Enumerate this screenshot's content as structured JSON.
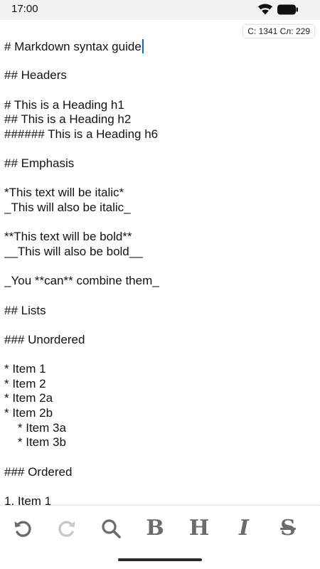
{
  "status_bar": {
    "time": "17:00",
    "wifi_icon": "wifi-icon",
    "battery_icon": "battery-icon"
  },
  "counter": {
    "text": "С: 1341 Сл: 229"
  },
  "editor": {
    "lines": [
      "# Markdown syntax guide",
      "",
      "## Headers",
      "",
      "# This is a Heading h1",
      "## This is a Heading h2",
      "###### This is a Heading h6",
      "",
      "## Emphasis",
      "",
      "*This text will be italic*",
      "_This will also be italic_",
      "",
      "**This text will be bold**",
      "__This will also be bold__",
      "",
      "_You **can** combine them_",
      "",
      "## Lists",
      "",
      "### Unordered",
      "",
      "* Item 1",
      "* Item 2",
      "* Item 2a",
      "* Item 2b",
      "    * Item 3a",
      "    * Item 3b",
      "",
      "### Ordered",
      "",
      "1. Item 1"
    ]
  },
  "toolbar": {
    "undo_icon": "undo-icon",
    "redo_icon": "redo-icon",
    "search_icon": "search-icon",
    "bold_label": "B",
    "heading_label": "H",
    "italic_label": "I",
    "strike_label": "S",
    "icon_color": "#6b6b6b",
    "disabled_color": "#c8c8c8"
  },
  "colors": {
    "caret": "#1565c0",
    "status_bar_bg": "#f2f2f2"
  }
}
